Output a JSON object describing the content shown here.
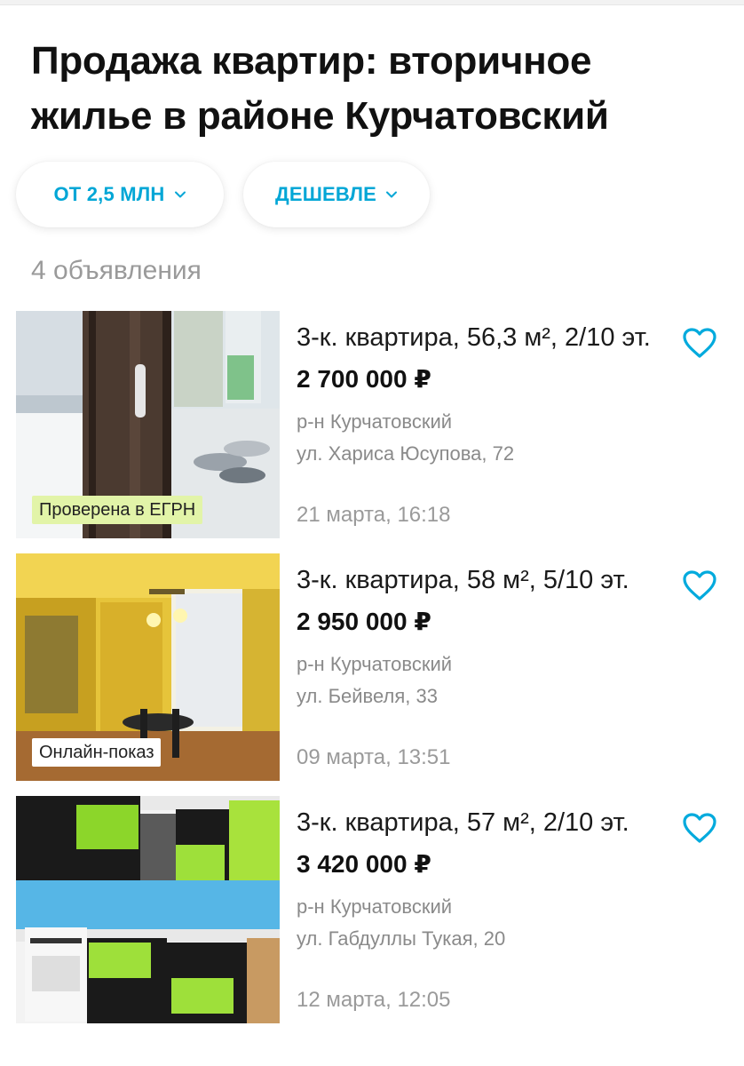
{
  "page": {
    "title": "Продажа квартир: вторичное жилье в районе Курчатовский",
    "count_label": "4 объявления"
  },
  "filters": [
    {
      "label": "ОТ 2,5 МЛН"
    },
    {
      "label": "ДЕШЕВЛЕ"
    }
  ],
  "colors": {
    "accent": "#00a6d6",
    "heart": "#00aadd",
    "badge_green": "#e2f4a8"
  },
  "listings": [
    {
      "heading": "3-к. квартира, 56,3 м², 2/10 эт.",
      "price": "2 700 000 ₽",
      "district": "р-н Курчатовский",
      "street": "ул. Хариса Юсупова, 72",
      "date": "21 марта, 16:18",
      "badge": "Проверена в ЕГРН",
      "icon": "heart-icon"
    },
    {
      "heading": "3-к. квартира, 58 м², 5/10 эт.",
      "price": "2 950 000 ₽",
      "district": "р-н Курчатовский",
      "street": "ул. Бейвеля, 33",
      "date": "09 марта, 13:51",
      "badge": "Онлайн-показ",
      "icon": "heart-icon"
    },
    {
      "heading": "3-к. квартира, 57 м², 2/10 эт.",
      "price": "3 420 000 ₽",
      "district": "р-н Курчатовский",
      "street": "ул. Габдуллы Тукая, 20",
      "date": "12 марта, 12:05",
      "icon": "heart-icon"
    }
  ]
}
